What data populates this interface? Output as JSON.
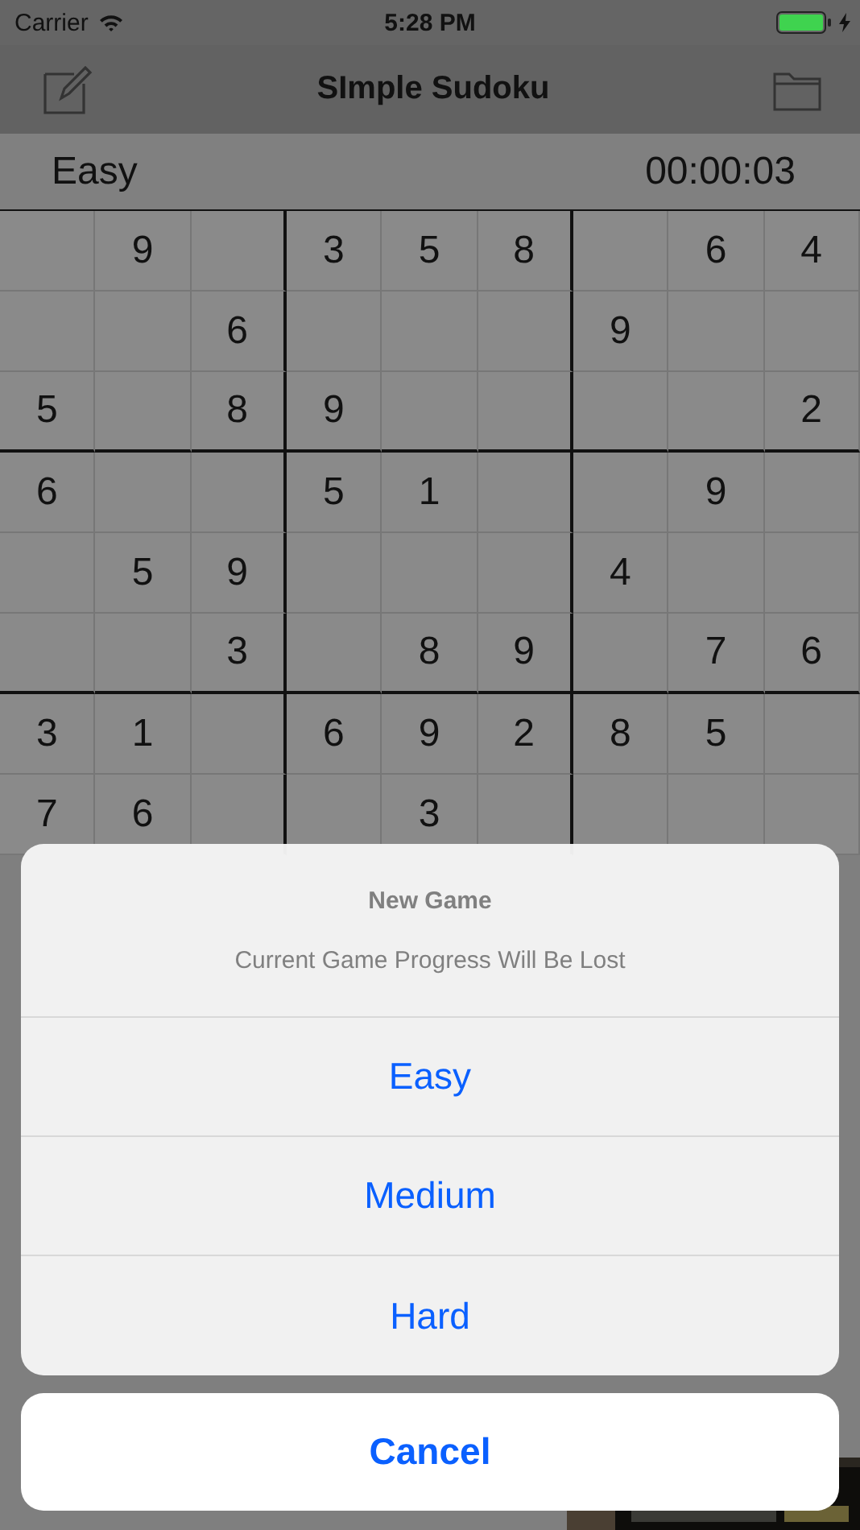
{
  "status_bar": {
    "carrier": "Carrier",
    "time": "5:28 PM"
  },
  "nav_bar": {
    "title": "SImple Sudoku"
  },
  "info_bar": {
    "difficulty": "Easy",
    "timer": "00:00:03"
  },
  "grid": {
    "rows": [
      [
        null,
        "9",
        null,
        "3",
        "5",
        "8",
        null,
        "6",
        "4"
      ],
      [
        null,
        null,
        "6",
        null,
        null,
        null,
        "9",
        null,
        null
      ],
      [
        "5",
        null,
        "8",
        "9",
        null,
        null,
        null,
        null,
        "2"
      ],
      [
        "6",
        null,
        null,
        "5",
        "1",
        null,
        null,
        "9",
        null
      ],
      [
        null,
        "5",
        "9",
        null,
        null,
        null,
        "4",
        null,
        null
      ],
      [
        null,
        null,
        "3",
        null,
        "8",
        "9",
        null,
        "7",
        "6"
      ],
      [
        "3",
        "1",
        null,
        "6",
        "9",
        "2",
        "8",
        "5",
        null
      ],
      [
        "7",
        "6",
        null,
        null,
        "3",
        null,
        null,
        null,
        null
      ]
    ]
  },
  "action_sheet": {
    "title": "New Game",
    "message": "Current Game Progress Will Be Lost",
    "actions": [
      {
        "label": "Easy",
        "kind": "default"
      },
      {
        "label": "Medium",
        "kind": "default"
      },
      {
        "label": "Hard",
        "kind": "default"
      },
      {
        "label": "Cancel",
        "kind": "cancel"
      }
    ]
  }
}
